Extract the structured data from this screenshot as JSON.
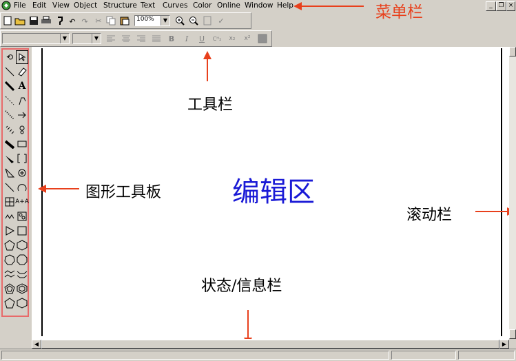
{
  "menubar": {
    "items": [
      {
        "label": "File"
      },
      {
        "label": "Edit"
      },
      {
        "label": "View"
      },
      {
        "label": "Object"
      },
      {
        "label": "Structure"
      },
      {
        "label": "Text"
      },
      {
        "label": "Curves"
      },
      {
        "label": "Color"
      },
      {
        "label": "Online"
      },
      {
        "label": "Window"
      },
      {
        "label": "Help"
      }
    ],
    "window_buttons": {
      "minimize": "_",
      "restore": "❐",
      "close": "×"
    }
  },
  "toolbar": {
    "zoom_value": "100%"
  },
  "format_toolbar": {
    "bold": "B",
    "italic": "I",
    "underline": "U"
  },
  "annotations": {
    "menubar_label": "菜单栏",
    "toolbar_label": "工具栏",
    "palette_label": "图形工具板",
    "editor_label": "编辑区",
    "scrollbar_label": "滚动栏",
    "status_label": "状态/信息栏"
  },
  "colors": {
    "annotation_red": "#e8401c",
    "editor_blue": "#1a1ad6",
    "palette_border": "#e86a6a"
  }
}
